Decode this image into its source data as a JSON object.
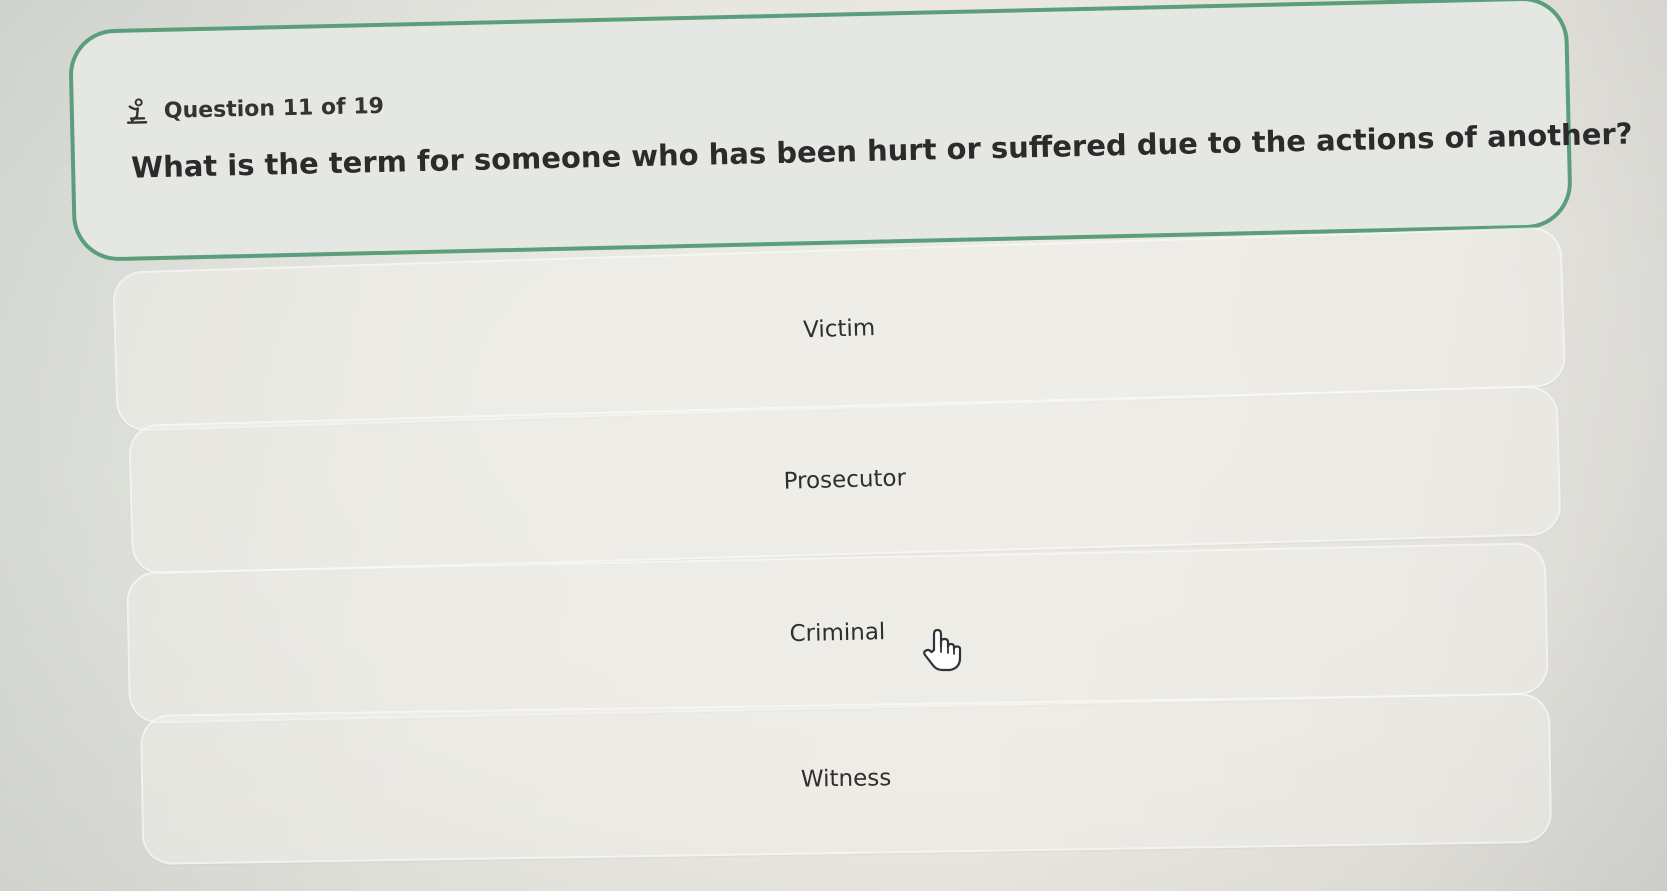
{
  "question": {
    "counter": "Question 11 of 19",
    "icon": "kneeling-figure-icon",
    "text": "What is the term for someone who has been hurt or suffered due to the actions of another?"
  },
  "answers": [
    {
      "label": "Victim"
    },
    {
      "label": "Prosecutor"
    },
    {
      "label": "Criminal"
    },
    {
      "label": "Witness"
    }
  ],
  "cursor": {
    "icon": "pointer-hand-icon"
  },
  "colors": {
    "accent_border": "#5a9e7c",
    "text": "#2b2b2b"
  }
}
